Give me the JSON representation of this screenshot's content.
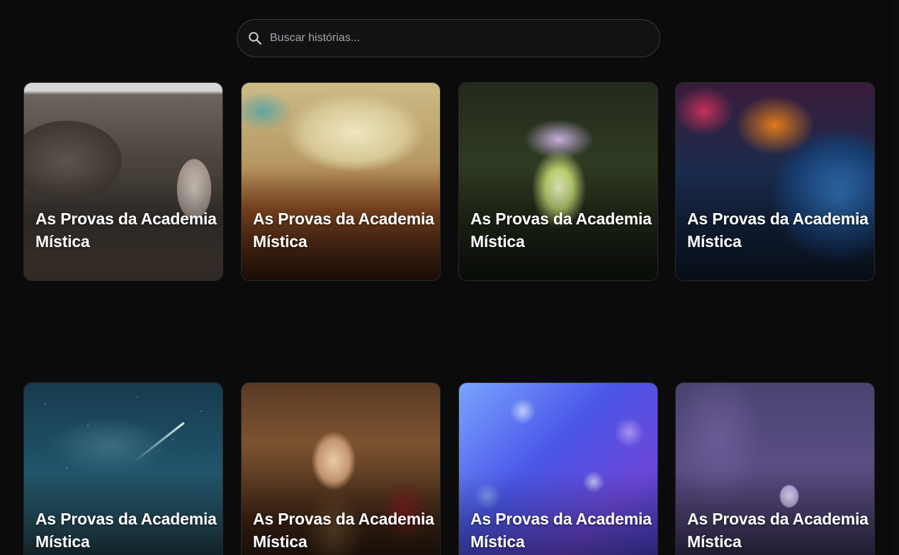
{
  "search": {
    "placeholder": "Buscar histórias..."
  },
  "stories": [
    {
      "title": "As Provas da Academia Mística",
      "image": "castle-forest"
    },
    {
      "title": "As Provas da Academia Mística",
      "image": "parchment-landscape"
    },
    {
      "title": "As Provas da Academia Mística",
      "image": "garden-archway"
    },
    {
      "title": "As Provas da Academia Mística",
      "image": "autumn-alley"
    },
    {
      "title": "As Provas da Academia Mística",
      "image": "starry-night-meteor"
    },
    {
      "title": "As Provas da Academia Mística",
      "image": "queen-in-palace"
    },
    {
      "title": "As Provas da Academia Mística",
      "image": "blue-bokeh"
    },
    {
      "title": "As Provas da Academia Mística",
      "image": "purple-flower"
    }
  ]
}
